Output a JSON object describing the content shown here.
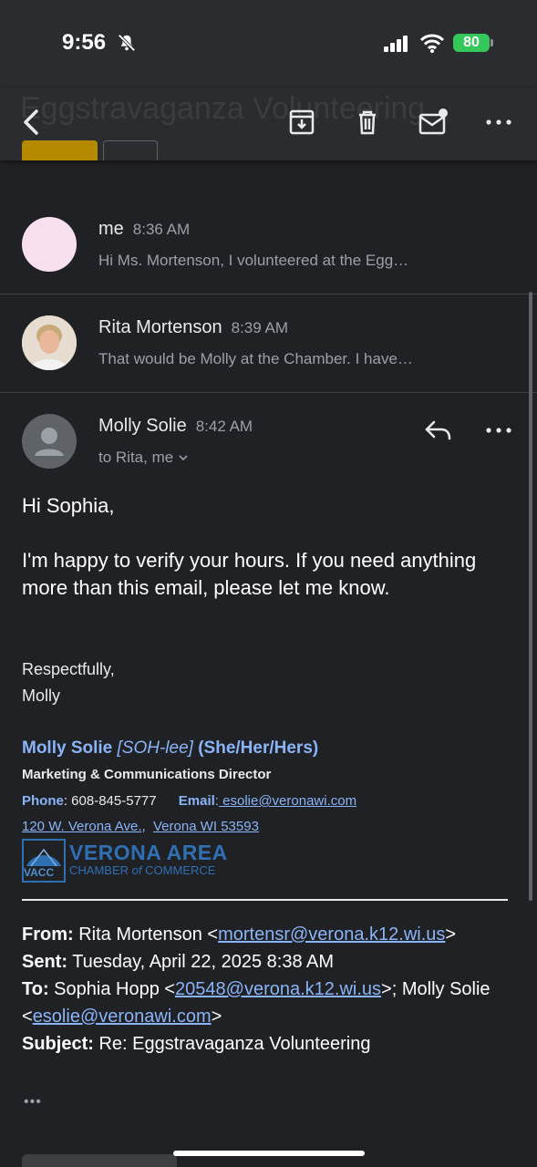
{
  "status": {
    "time": "9:56",
    "battery": "80"
  },
  "toolbar": {
    "ghost_title": "Eggstravaganza Volunteering"
  },
  "thread": [
    {
      "sender": "me",
      "time": "8:36 AM",
      "snippet": "Hi Ms. Mortenson, I volunteered at the Egg…"
    },
    {
      "sender": "Rita Mortenson",
      "time": "8:39 AM",
      "snippet": "That would be Molly at the Chamber. I have…"
    }
  ],
  "open_message": {
    "sender": "Molly Solie",
    "time": "8:42 AM",
    "recipients": "to Rita, me",
    "greeting": "Hi Sophia,",
    "body": "I'm happy to verify your hours. If you need anything more than this email, please let me know.",
    "closing": "Respectfully,",
    "closing_name": "Molly"
  },
  "signature": {
    "name": "Molly Solie",
    "pronunciation": "[SOH-lee]",
    "pronouns": "(She/Her/Hers)",
    "title": "Marketing & Communications Director",
    "phone_label": "Phone",
    "phone": ": 608-845-5777",
    "email_label": "Email",
    "email": " esolie@veronawi.com",
    "address1": "120 W. Verona Ave.",
    "address2": "Verona WI 53593",
    "logo_abbr": "VACC",
    "logo_name": "VERONA AREA",
    "logo_sub_1": "CHAMBER",
    "logo_sub_of": "of",
    "logo_sub_2": "COMMERCE"
  },
  "quoted_header": {
    "from_label": "From:",
    "from_name": " Rita Mortenson <",
    "from_email": "mortensr@verona.k12.wi.us",
    "from_end": ">",
    "sent_label": "Sent:",
    "sent": " Tuesday, April 22, 2025 8:38 AM",
    "to_label": "To:",
    "to_name1": " Sophia Hopp <",
    "to_email1": "20548@verona.k12.wi.us",
    "to_mid": ">; Molly Solie <",
    "to_email2": "esolie@veronawi.com",
    "to_end": ">",
    "subject_label": "Subject:",
    "subject": " Re: Eggstravaganza Volunteering"
  },
  "more_dots": "•••",
  "colors": {
    "background": "#202124",
    "toolbar": "#2b2c2f",
    "link": "#8ab4f8",
    "battery": "#34c759"
  }
}
